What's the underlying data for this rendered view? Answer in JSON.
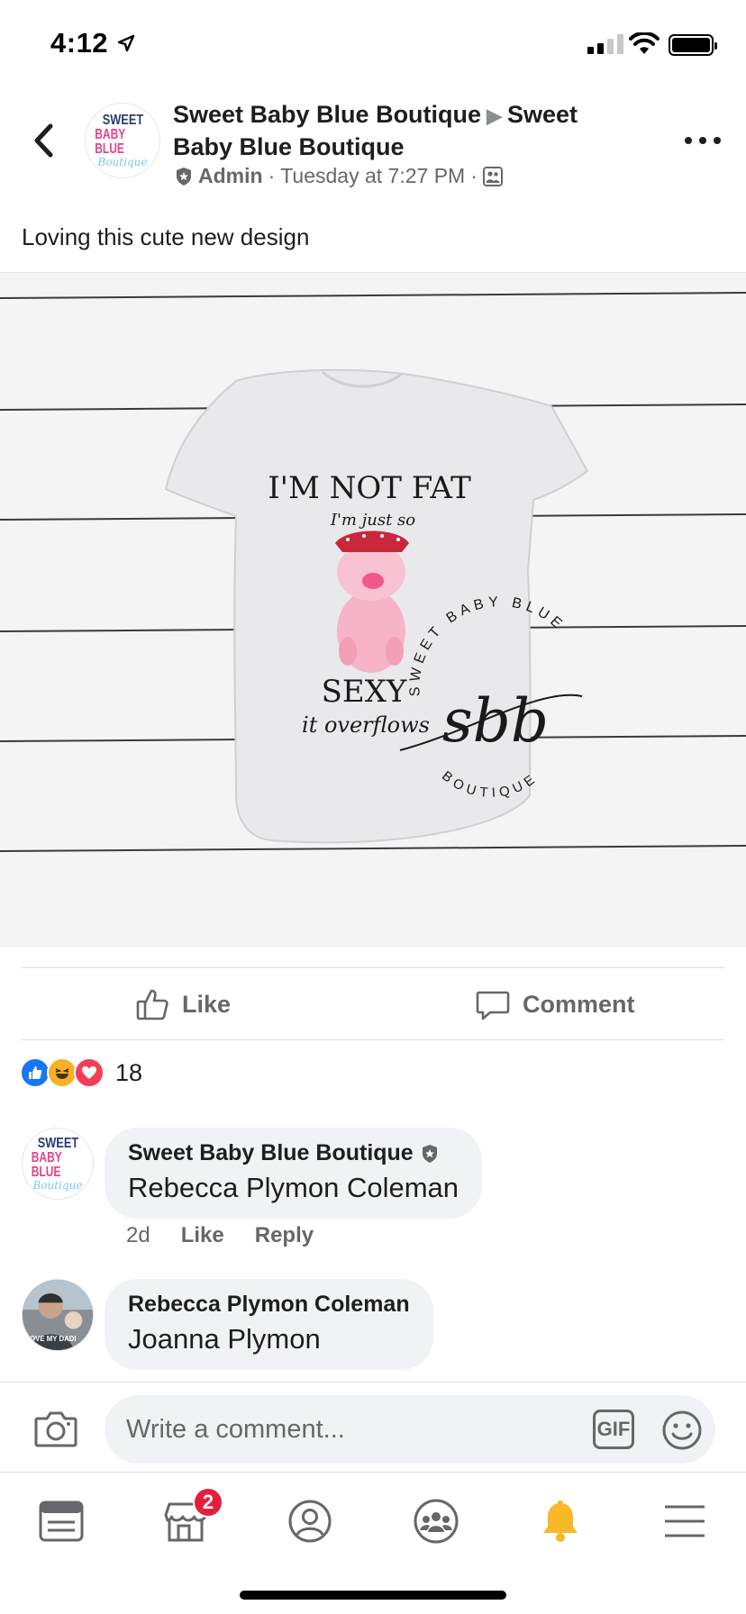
{
  "status_bar": {
    "time": "4:12"
  },
  "post": {
    "page_name": "Sweet Baby Blue Boutique",
    "shared_to": "Sweet Baby Blue Boutique",
    "role": "Admin",
    "timestamp": "Tuesday at 7:27 PM",
    "separator": "·",
    "text": "Loving this cute new design",
    "avatar_logo": {
      "line1": "SWEET",
      "line2": "BABY BLUE",
      "line3": "Boutique"
    },
    "image": {
      "shirt_text_1": "I'M NOT FAT",
      "shirt_text_2": "I'm just so",
      "shirt_text_3": "SEXY",
      "shirt_text_4": "it overflows",
      "watermark_top": "SWEET BABY BLUE",
      "watermark_mono": "sbb",
      "watermark_bottom": "BOUTIQUE"
    }
  },
  "actions": {
    "like_label": "Like",
    "comment_label": "Comment"
  },
  "reactions": {
    "count": "18",
    "colors": {
      "like": "#1877f2",
      "haha": "#f7b125",
      "love": "#f33e58"
    }
  },
  "comments": [
    {
      "author": "Sweet Baby Blue Boutique",
      "text": "Rebecca Plymon Coleman",
      "age": "2d",
      "like_label": "Like",
      "reply_label": "Reply"
    },
    {
      "author": "Rebecca Plymon Coleman",
      "text": "Joanna Plymon",
      "avatar_shirt_text": "I LOVE MY DADI"
    }
  ],
  "composer": {
    "placeholder": "Write a comment...",
    "gif_label": "GIF"
  },
  "tab_bar": {
    "marketplace_badge": "2"
  },
  "colors": {
    "accent": "#1877f2",
    "badge": "#e41e3f",
    "bell": "#f7b928",
    "text_secondary": "#65676b"
  }
}
